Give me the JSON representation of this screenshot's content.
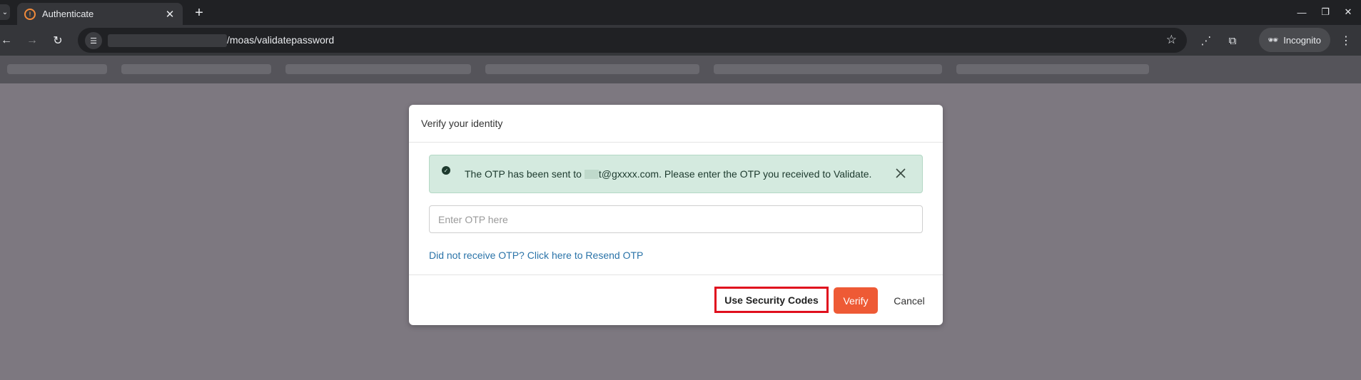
{
  "browser": {
    "tab": {
      "title": "Authenticate"
    },
    "url": {
      "path": "/moas/validatepassword"
    },
    "incognito_label": "Incognito"
  },
  "modal": {
    "title": "Verify your identity",
    "alert": {
      "text_before": "The OTP has been sent to",
      "text_after": "t@gxxxx.com. Please enter the OTP you received to Validate."
    },
    "otp_input": {
      "placeholder": "Enter OTP here",
      "value": ""
    },
    "resend_link": "Did not receive OTP? Click here to Resend OTP",
    "buttons": {
      "security_codes": "Use Security Codes",
      "verify": "Verify",
      "cancel": "Cancel"
    }
  },
  "colors": {
    "verify_button": "#ee5a35",
    "alert_background": "#d4eadf",
    "link": "#2a73a8",
    "highlight_border": "#e0101e"
  }
}
